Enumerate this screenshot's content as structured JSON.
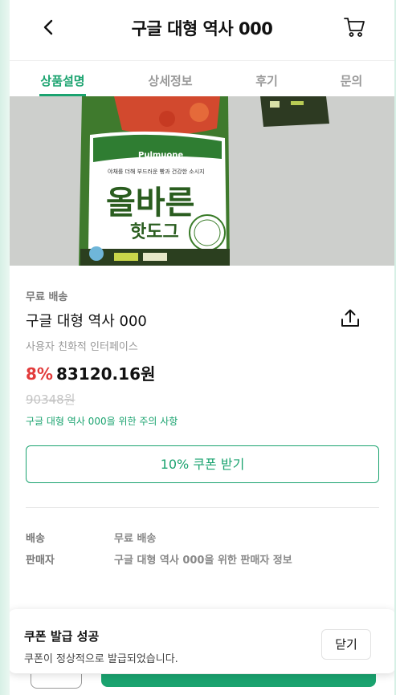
{
  "header": {
    "title": "구글 대형 역사 000",
    "back_icon": "chevron-left-icon",
    "cart_icon": "cart-icon"
  },
  "tabs": [
    {
      "label": "상품설명",
      "active": true
    },
    {
      "label": "상세정보",
      "active": false
    },
    {
      "label": "후기",
      "active": false
    },
    {
      "label": "문의",
      "active": false
    }
  ],
  "product": {
    "image_brand": "Pulmuone",
    "image_title": "올바른",
    "image_subtitle": "핫도그",
    "shipping_label": "무료 배송",
    "name": "구글 대형 역사 000",
    "description": "사용자 친화적 인터페이스",
    "discount": "8%",
    "price": "83120.16원",
    "original_price": "90348원",
    "notice_link": "구글 대형 역사 000을 위한 주의 사항",
    "coupon_button": "10% 쿠폰 받기",
    "share_icon": "share-icon"
  },
  "info": {
    "shipping_key": "배송",
    "shipping_value": "무료 배송",
    "seller_key": "판매자",
    "seller_value": "구글 대형 역사 000을 위한 판매자 정보"
  },
  "toast": {
    "title": "쿠폰 발급 성공",
    "message": "쿠폰이 정상적으로 발급되었습니다.",
    "close_label": "닫기"
  },
  "colors": {
    "accent": "#1aa36f",
    "discount": "#e23a3a"
  }
}
